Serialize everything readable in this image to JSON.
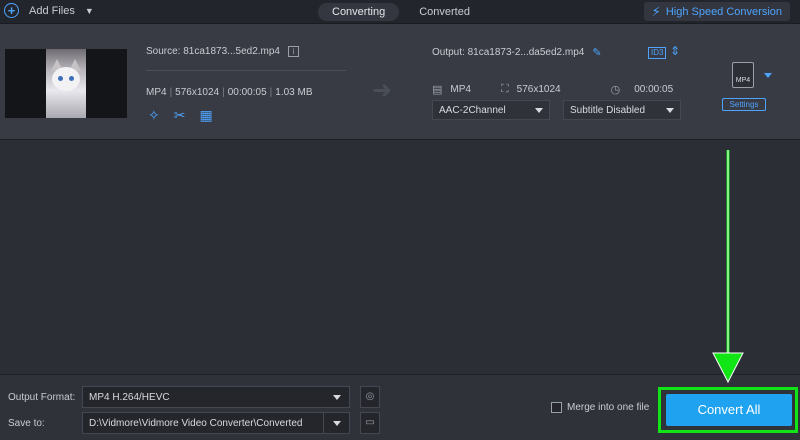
{
  "topbar": {
    "add_files_label": "Add Files",
    "tabs": [
      {
        "label": "Converting",
        "active": true
      },
      {
        "label": "Converted",
        "active": false
      }
    ],
    "high_speed_label": "High Speed Conversion"
  },
  "file": {
    "source": "Source: 81ca1873...5ed2.mp4",
    "format": "MP4",
    "resolution": "576x1024",
    "duration": "00:00:05",
    "size": "1.03 MB",
    "output": "Output: 81ca1873-2...da5ed2.mp4",
    "out_format": "MP4",
    "out_resolution": "576x1024",
    "out_duration": "00:00:05",
    "audio": "AAC-2Channel",
    "subtitle": "Subtitle Disabled",
    "format_icon_label": "MP4",
    "settings_label": "Settings",
    "id3_label": "ID3"
  },
  "bottom": {
    "output_format_label": "Output Format:",
    "output_format_value": "MP4 H.264/HEVC",
    "save_to_label": "Save to:",
    "save_to_value": "D:\\Vidmore\\Vidmore Video Converter\\Converted",
    "merge_label": "Merge into one file",
    "convert_all_label": "Convert All"
  },
  "colors": {
    "accent": "#4ea3ff",
    "convert_button": "#1fa2f0",
    "annotation": "#12e516"
  }
}
